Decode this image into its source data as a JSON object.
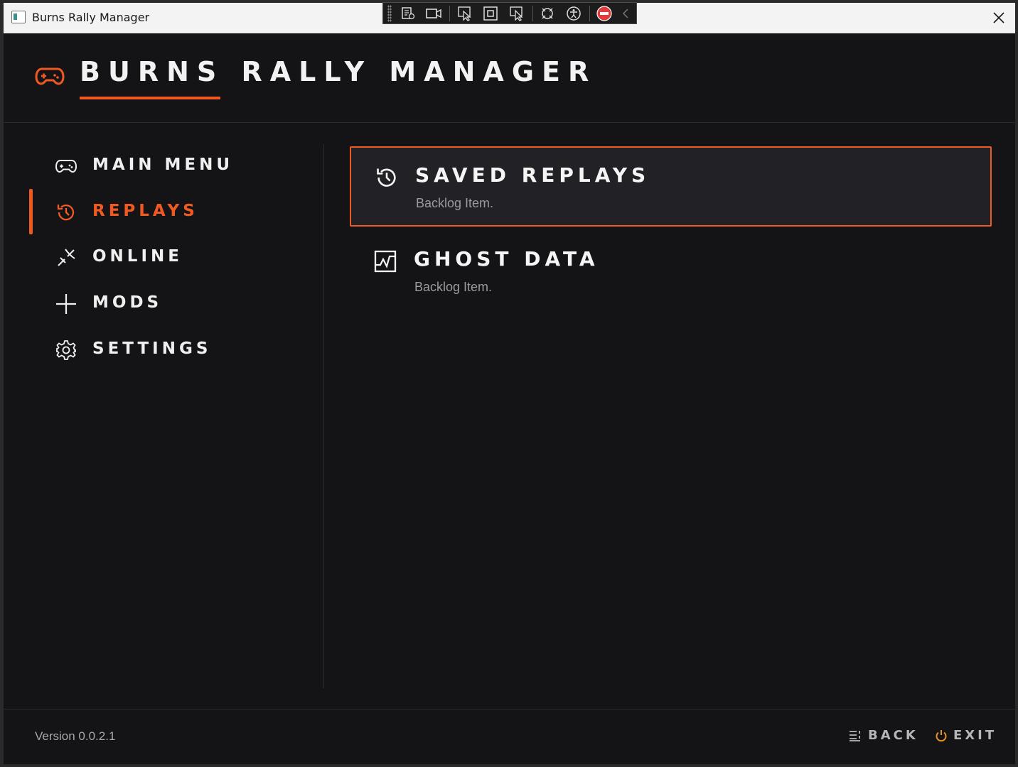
{
  "window": {
    "title": "Burns Rally Manager"
  },
  "app": {
    "brand": "BURNS RALLY MANAGER",
    "accent_color": "#f05a22"
  },
  "sidebar": {
    "items": [
      {
        "label": "MAIN MENU",
        "icon": "gamepad-icon",
        "active": false
      },
      {
        "label": "REPLAYS",
        "icon": "history-icon",
        "active": true
      },
      {
        "label": "ONLINE",
        "icon": "connection-icon",
        "active": false
      },
      {
        "label": "MODS",
        "icon": "plus-icon",
        "active": false
      },
      {
        "label": "SETTINGS",
        "icon": "gear-icon",
        "active": false
      }
    ]
  },
  "content": {
    "items": [
      {
        "title": "SAVED REPLAYS",
        "subtitle": "Backlog Item.",
        "icon": "history-icon",
        "selected": true
      },
      {
        "title": "GHOST DATA",
        "subtitle": "Backlog Item.",
        "icon": "chart-icon",
        "selected": false
      }
    ]
  },
  "footer": {
    "version": "Version 0.0.2.1",
    "back_label": "BACK",
    "exit_label": "EXIT"
  }
}
